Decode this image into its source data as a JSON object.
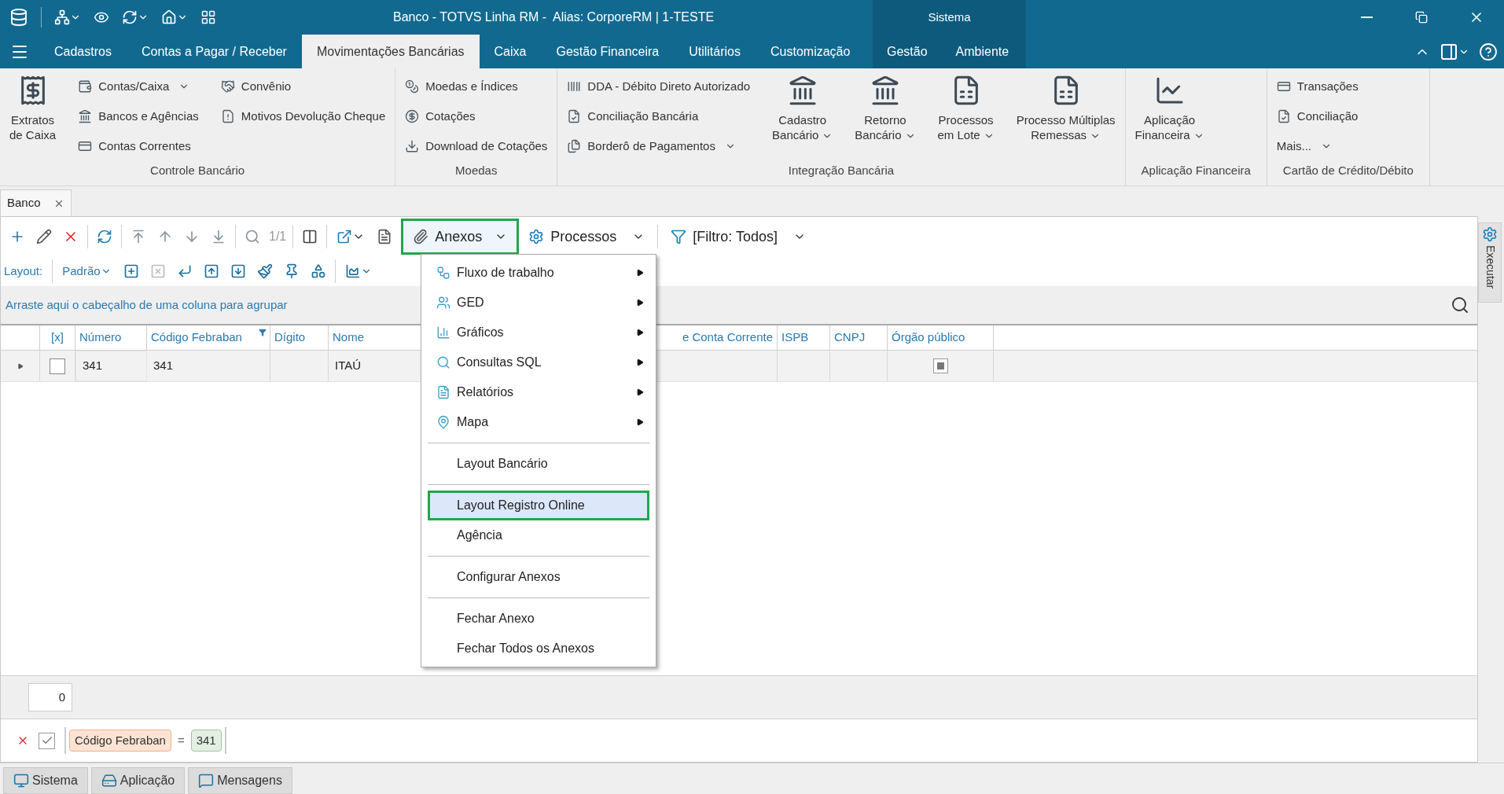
{
  "title_bar": {
    "title": "Banco - TOTVS Linha RM -  Alias: CorporeRM | 1-TESTE",
    "context_label": "Sistema"
  },
  "ribbon_tabs": [
    {
      "label": "Cadastros",
      "selected": false
    },
    {
      "label": "Contas a Pagar / Receber",
      "selected": false
    },
    {
      "label": "Movimentações Bancárias",
      "selected": true
    },
    {
      "label": "Caixa",
      "selected": false
    },
    {
      "label": "Gestão Financeira",
      "selected": false
    },
    {
      "label": "Utilitários",
      "selected": false
    },
    {
      "label": "Customização",
      "selected": false
    }
  ],
  "context_tabs": [
    {
      "label": "Gestão",
      "selected": false
    },
    {
      "label": "Ambiente",
      "selected": false
    }
  ],
  "ribbon_groups": [
    {
      "label": "Controle Bancário",
      "columns": [
        {
          "kind": "large",
          "items": [
            {
              "lines": [
                "Extratos",
                "de Caixa"
              ],
              "dropdown": false
            }
          ]
        },
        {
          "kind": "small",
          "items": [
            {
              "lines": [
                "Contas/Caixa"
              ],
              "dropdown": true
            },
            {
              "lines": [
                "Bancos e Agências"
              ],
              "dropdown": false
            },
            {
              "lines": [
                "Contas Correntes"
              ],
              "dropdown": false
            }
          ]
        },
        {
          "kind": "small",
          "items": [
            {
              "lines": [
                "Convênio"
              ],
              "dropdown": false
            },
            {
              "lines": [
                "Motivos Devolução Cheque"
              ],
              "dropdown": false
            }
          ]
        }
      ]
    },
    {
      "label": "Moedas",
      "columns": [
        {
          "kind": "small",
          "items": [
            {
              "lines": [
                "Moedas e Índices"
              ],
              "dropdown": false
            },
            {
              "lines": [
                "Cotações"
              ],
              "dropdown": false
            },
            {
              "lines": [
                "Download de Cotações"
              ],
              "dropdown": false
            }
          ]
        }
      ]
    },
    {
      "label": "Integração Bancária",
      "columns": [
        {
          "kind": "small",
          "items": [
            {
              "lines": [
                "DDA - Débito Direto Autorizado"
              ],
              "dropdown": false
            },
            {
              "lines": [
                "Conciliação Bancária"
              ],
              "dropdown": false
            },
            {
              "lines": [
                "Borderô de Pagamentos"
              ],
              "dropdown": true
            }
          ]
        },
        {
          "kind": "large",
          "items": [
            {
              "lines": [
                "Cadastro",
                "Bancário"
              ],
              "dropdown": true
            }
          ]
        },
        {
          "kind": "large",
          "items": [
            {
              "lines": [
                "Retorno",
                "Bancário"
              ],
              "dropdown": true
            }
          ]
        },
        {
          "kind": "large",
          "items": [
            {
              "lines": [
                "Processos",
                "em Lote"
              ],
              "dropdown": true
            }
          ]
        },
        {
          "kind": "large",
          "items": [
            {
              "lines": [
                "Processo Múltiplas",
                "Remessas"
              ],
              "dropdown": true
            }
          ]
        }
      ]
    },
    {
      "label": "Aplicação Financeira",
      "columns": [
        {
          "kind": "large",
          "items": [
            {
              "lines": [
                "Aplicação",
                "Financeira"
              ],
              "dropdown": true
            }
          ]
        }
      ]
    },
    {
      "label": "Cartão de Crédito/Débito",
      "columns": [
        {
          "kind": "small",
          "items": [
            {
              "lines": [
                "Transações"
              ],
              "dropdown": false
            },
            {
              "lines": [
                "Conciliação"
              ],
              "dropdown": false
            },
            {
              "lines": [
                "Mais..."
              ],
              "dropdown": true
            }
          ]
        }
      ]
    }
  ],
  "document_tabs": [
    {
      "label": "Banco",
      "selected": true
    }
  ],
  "toolbar": {
    "counter": "1/1",
    "attachments_button": "Anexos",
    "processes_button": "Processos",
    "filter_button": "[Filtro: Todos]",
    "layout_label": "Layout:",
    "layout_value": "Padrão"
  },
  "group_panel": {
    "hint": "Arraste aqui o cabeçalho de uma coluna para agrupar"
  },
  "grid": {
    "columns": [
      {
        "label": "[x]",
        "kind": "check",
        "filtered": false
      },
      {
        "label": "Número",
        "kind": "text",
        "filtered": false
      },
      {
        "label": "Código Febraban",
        "kind": "text",
        "filtered": true
      },
      {
        "label": "Dígito",
        "kind": "text",
        "filtered": false
      },
      {
        "label": "Nome",
        "kind": "text",
        "filtered": false
      },
      {
        "label": "e Conta Corrente",
        "kind": "text",
        "filtered": false
      },
      {
        "label": "ISPB",
        "kind": "text",
        "filtered": false
      },
      {
        "label": "CNPJ",
        "kind": "text",
        "filtered": false
      },
      {
        "label": "Órgão público",
        "kind": "flag",
        "filtered": false
      }
    ],
    "rows": [
      {
        "checked": false,
        "cells": [
          "",
          "341",
          "341",
          "",
          "ITAÚ",
          "",
          "",
          "",
          ""
        ],
        "flag_indeterminate": true
      }
    ]
  },
  "footer": {
    "count": "0"
  },
  "filter_bar": {
    "enabled": true,
    "field": "Código Febraban",
    "operator": "=",
    "value": "341"
  },
  "attachments_menu": {
    "items": [
      {
        "kind": "submenu",
        "label": "Fluxo de trabalho",
        "selected": false
      },
      {
        "kind": "submenu",
        "label": "GED",
        "selected": false
      },
      {
        "kind": "submenu",
        "label": "Gráficos",
        "selected": false
      },
      {
        "kind": "submenu",
        "label": "Consultas SQL",
        "selected": false
      },
      {
        "kind": "submenu",
        "label": "Relatórios",
        "selected": false
      },
      {
        "kind": "submenu",
        "label": "Mapa",
        "selected": false
      },
      {
        "kind": "separator"
      },
      {
        "kind": "command",
        "label": "Layout Bancário",
        "selected": false
      },
      {
        "kind": "separator"
      },
      {
        "kind": "command",
        "label": "Layout Registro Online",
        "selected": true
      },
      {
        "kind": "command",
        "label": "Agência",
        "selected": false
      },
      {
        "kind": "separator"
      },
      {
        "kind": "command",
        "label": "Configurar Anexos",
        "selected": false
      },
      {
        "kind": "separator"
      },
      {
        "kind": "command",
        "label": "Fechar Anexo",
        "selected": false
      },
      {
        "kind": "command",
        "label": "Fechar Todos os Anexos",
        "selected": false
      }
    ]
  },
  "side_panel": {
    "label": "Executar"
  },
  "status_tabs": [
    {
      "label": "Sistema"
    },
    {
      "label": "Aplicação"
    },
    {
      "label": "Mensagens"
    }
  ]
}
